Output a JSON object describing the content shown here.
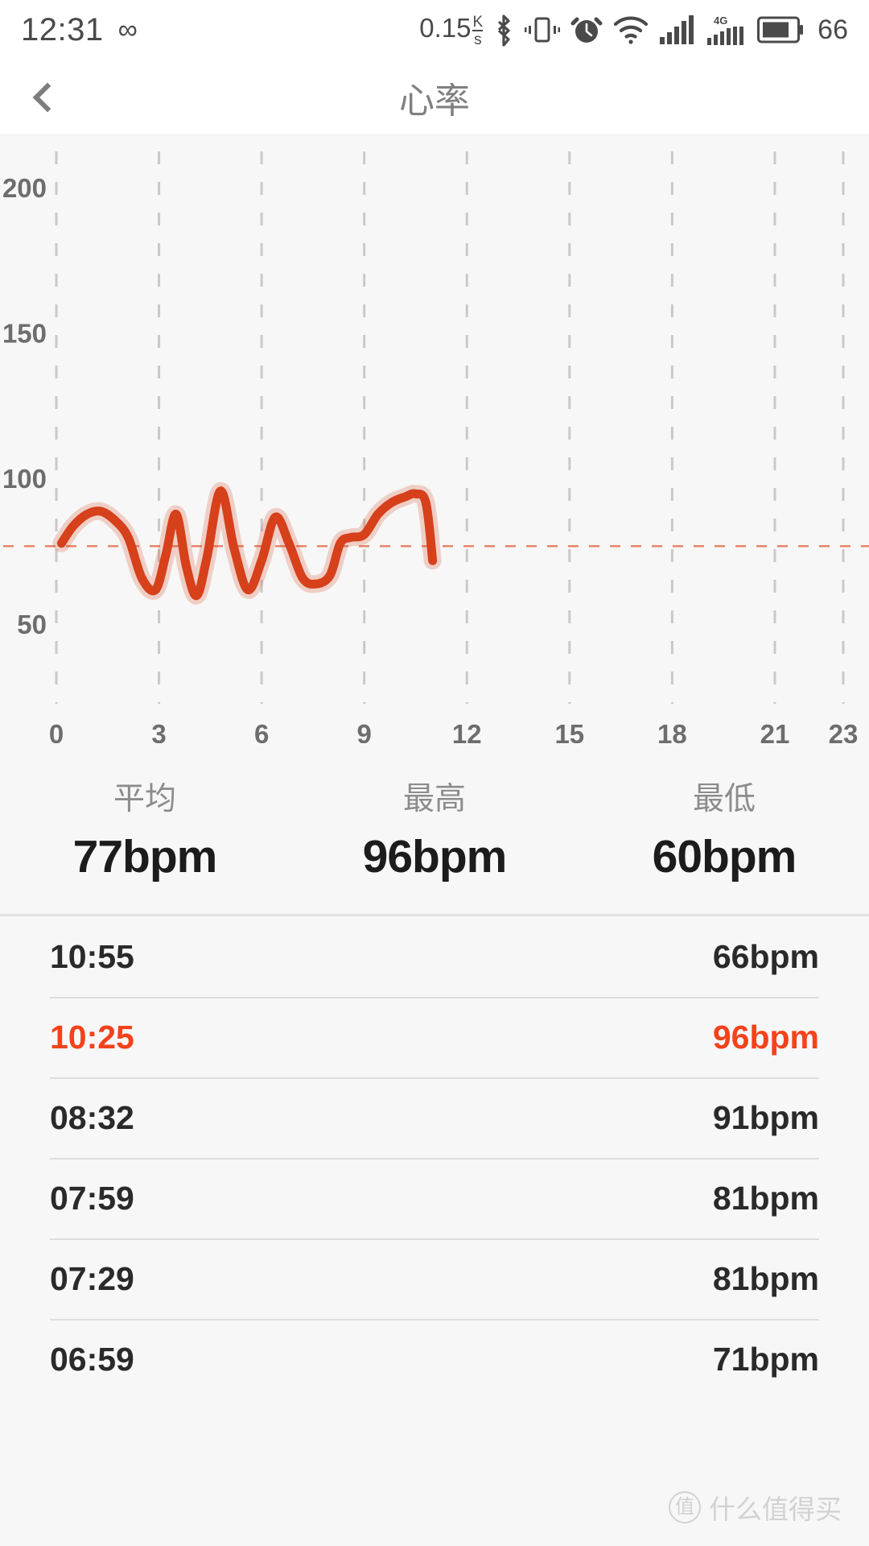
{
  "statusbar": {
    "time": "12:31",
    "infinity_icon": "∞",
    "net_speed": "0.15",
    "net_unit_num": "K",
    "net_unit_den": "s",
    "battery_percent": "66",
    "icons": [
      "bluetooth-icon",
      "vibrate-icon",
      "alarm-icon",
      "wifi-icon",
      "signal-icon",
      "4g-signal-icon",
      "battery-icon"
    ],
    "network_type": "4G"
  },
  "titlebar": {
    "back_label": "‹",
    "title": "心率"
  },
  "chart_data": {
    "type": "line",
    "title": "心率",
    "xlabel": "",
    "ylabel": "",
    "xlim": [
      0,
      23
    ],
    "ylim": [
      30,
      215
    ],
    "grid": true,
    "grid_style": "dashed-vertical",
    "x_ticks": [
      "0",
      "3",
      "6",
      "9",
      "12",
      "15",
      "18",
      "21",
      "23"
    ],
    "y_ticks": [
      "200",
      "150",
      "100",
      "50"
    ],
    "line_color": "#d6401a",
    "average_line_color": "#e8856a",
    "average_line_value": 77,
    "series": [
      {
        "name": "heart-rate",
        "x": [
          0.15,
          0.5,
          0.9,
          1.3,
          1.7,
          2.1,
          2.5,
          2.9,
          3.2,
          3.5,
          3.8,
          4.1,
          4.4,
          4.8,
          5.2,
          5.6,
          6.0,
          6.4,
          6.8,
          7.2,
          7.6,
          8.0,
          8.3,
          8.6,
          9.0,
          9.4,
          9.8,
          10.2,
          10.5,
          10.8,
          11.0
        ],
        "values": [
          78,
          84,
          88,
          89,
          86,
          80,
          66,
          62,
          74,
          88,
          70,
          60,
          73,
          96,
          76,
          62,
          72,
          87,
          78,
          66,
          64,
          67,
          78,
          80,
          81,
          88,
          92,
          94,
          95,
          92,
          72
        ]
      }
    ]
  },
  "summary": {
    "cells": [
      {
        "label": "平均",
        "value": "77bpm"
      },
      {
        "label": "最高",
        "value": "96bpm"
      },
      {
        "label": "最低",
        "value": "60bpm"
      }
    ]
  },
  "list": {
    "rows": [
      {
        "time": "10:55",
        "bpm": "66bpm",
        "highlight": false
      },
      {
        "time": "10:25",
        "bpm": "96bpm",
        "highlight": true
      },
      {
        "time": "08:32",
        "bpm": "91bpm",
        "highlight": false
      },
      {
        "time": "07:59",
        "bpm": "81bpm",
        "highlight": false
      },
      {
        "time": "07:29",
        "bpm": "81bpm",
        "highlight": false
      },
      {
        "time": "06:59",
        "bpm": "71bpm",
        "highlight": false
      }
    ]
  },
  "watermark": {
    "badge": "值",
    "text": "什么值得买"
  },
  "colors": {
    "accent": "#f4431c",
    "line": "#d6401a",
    "page_bg": "#f7f7f7",
    "bar_bg": "#ffffff"
  }
}
